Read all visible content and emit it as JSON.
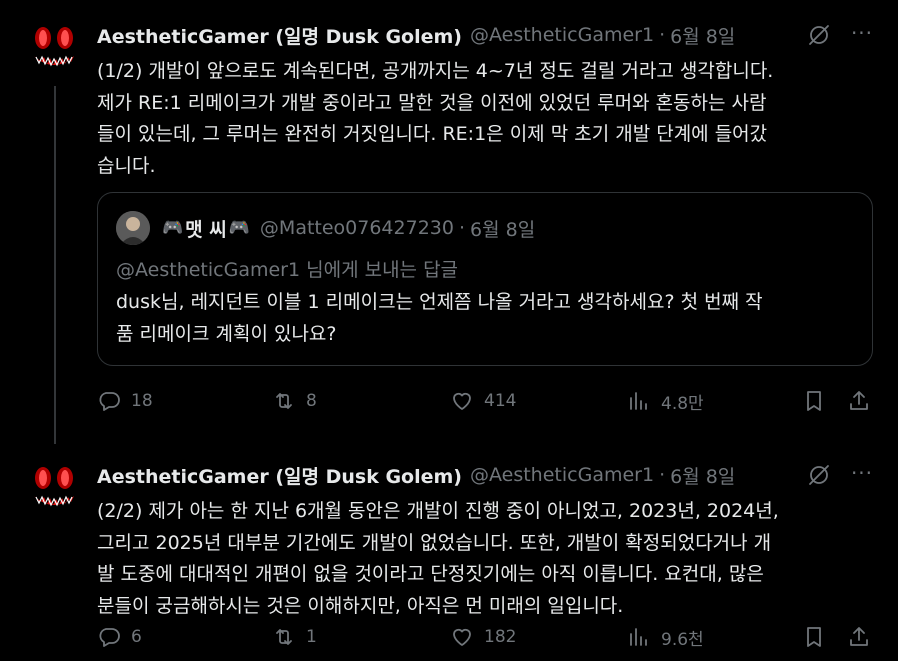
{
  "tweets": [
    {
      "author_name": "AestheticGamer (일명 Dusk Golem)",
      "handle": "@AestheticGamer1",
      "separator": "·",
      "date": "6월 8일",
      "text": "(1/2) 개발이 앞으로도 계속된다면, 공개까지는 4~7년 정도 걸릴 거라고 생각합니다.\n제가 RE:1 리메이크가 개발 중이라고 말한 것을 이전에 있었던 루머와 혼동하는 사람\n들이 있는데, 그 루머는 완전히 거짓입니다. RE:1은 이제 막 초기 개발 단계에 들어갔\n습니다.",
      "quote": {
        "author_name": "맷 씨",
        "pad_icon": "🎮",
        "handle": "@Matteo076427230",
        "separator": "·",
        "date": "6월 8일",
        "reply_to": "@AestheticGamer1 님에게 보내는 답글",
        "text": "dusk님, 레지던트 이블 1 리메이크는 언제쯤 나올 거라고 생각하세요? 첫 번째 작\n품 리메이크 계획이 있나요?"
      },
      "actions": {
        "replies": "18",
        "reposts": "8",
        "likes": "414",
        "views": "4.8만"
      }
    },
    {
      "author_name": "AestheticGamer (일명 Dusk Golem)",
      "handle": "@AestheticGamer1",
      "separator": "·",
      "date": "6월 8일",
      "text": "(2/2) 제가 아는 한 지난 6개월 동안은 개발이 진행 중이 아니었고, 2023년, 2024년,\n그리고 2025년 대부분 기간에도 개발이 없었습니다. 또한, 개발이 확정되었다거나 개\n발 도중에 대대적인 개편이 없을 것이라고 단정짓기에는 아직 이릅니다. 요컨대, 많은\n분들이 궁금해하시는 것은 이해하지만, 아직은 먼 미래의 일입니다.",
      "actions": {
        "replies": "6",
        "reposts": "1",
        "likes": "182",
        "views": "9.6천"
      }
    }
  ],
  "icons": {
    "reply": "reply-icon",
    "repost": "repost-icon",
    "like": "heart-icon",
    "views": "views-chart-icon",
    "bookmark": "bookmark-icon",
    "share": "share-icon",
    "grok": "grok-icon",
    "more": "more-dots-icon"
  },
  "colors": {
    "background": "#000000",
    "text": "#e7e9ea",
    "secondary": "#71767b",
    "border": "#2f3336",
    "avatar_eyes": "#ff3b3b"
  },
  "more_glyph": "···"
}
